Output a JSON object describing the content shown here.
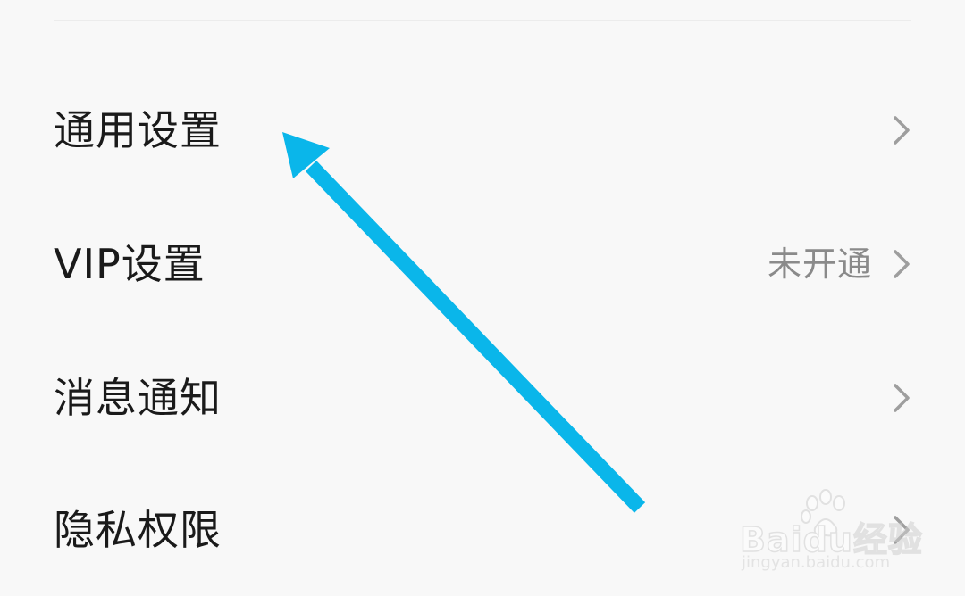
{
  "settings": {
    "items": [
      {
        "label": "通用设置",
        "value": ""
      },
      {
        "label": "VIP设置",
        "value": "未开通"
      },
      {
        "label": "消息通知",
        "value": ""
      },
      {
        "label": "隐私权限",
        "value": ""
      }
    ]
  },
  "watermark": {
    "brand": "Baidu经验",
    "url": "jingyan.baidu.com"
  },
  "colors": {
    "background": "#f8f8f8",
    "text": "#1a1a1a",
    "secondary_text": "#8a8a8a",
    "chevron": "#9e9e9e",
    "annotation_arrow": "#0ab6ea"
  },
  "icons": {
    "chevron": "chevron-right-icon",
    "annotation": "annotation-arrow-icon",
    "watermark": "paw-icon"
  }
}
